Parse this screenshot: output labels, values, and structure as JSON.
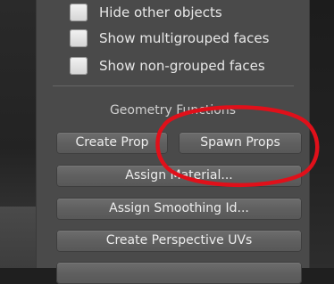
{
  "options": [
    {
      "label": "Hide other objects"
    },
    {
      "label": "Show multigrouped faces"
    },
    {
      "label": "Show non-grouped faces"
    }
  ],
  "geometry_functions": {
    "title": "Geometry Functions",
    "create_prop_label": "Create Prop",
    "spawn_props_label": "Spawn Props",
    "assign_material_label": "Assign Material...",
    "assign_smoothing_label": "Assign Smoothing Id...",
    "create_uvs_label": "Create Perspective UVs"
  },
  "colors": {
    "panel_bg": "#4a4a4a",
    "button_bg": "#616161",
    "annotation": "#e0101a",
    "text": "#e8e8e8"
  }
}
